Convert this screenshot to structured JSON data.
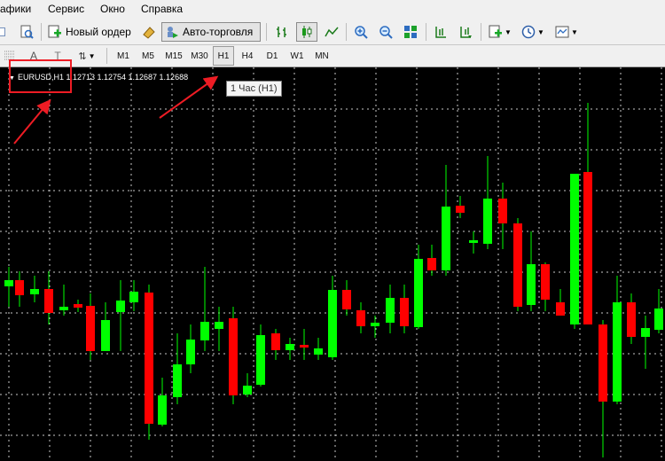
{
  "menu": {
    "items": [
      "афики",
      "Сервис",
      "Окно",
      "Справка"
    ]
  },
  "toolbar": {
    "new_order_label": "Новый ордер",
    "autotrade_label": "Авто-торговля"
  },
  "timeframes": {
    "items": [
      "M1",
      "M5",
      "M15",
      "M30",
      "H1",
      "H4",
      "D1",
      "W1",
      "MN"
    ],
    "active": "H1"
  },
  "tooltip": {
    "text": "1 Час (H1)"
  },
  "chart": {
    "header": "EURUSD,H1 1.12713 1.12754 1.12687 1.12688",
    "colors": {
      "background": "#000000",
      "grid": "#c8c8c8",
      "bull": "#00ff00",
      "bear": "#ff0000",
      "wick": "#00ff00"
    }
  },
  "annotation": {
    "color": "#ee1c24"
  }
}
